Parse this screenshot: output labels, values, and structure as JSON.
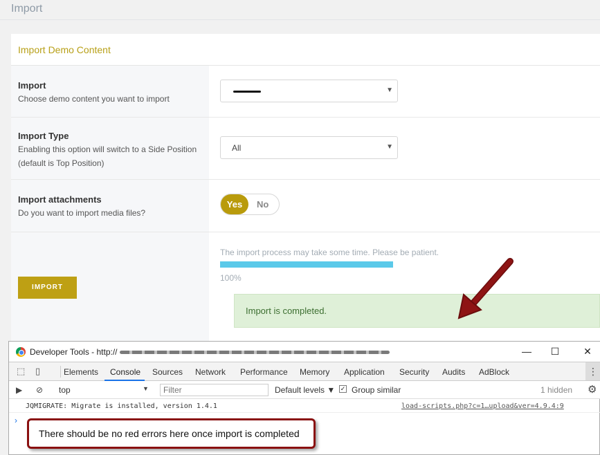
{
  "page": {
    "title": "Import"
  },
  "panel": {
    "title": "Import Demo Content",
    "rows": [
      {
        "label": "Import",
        "desc": [
          "Choose demo content you want to import"
        ],
        "select_value": ""
      },
      {
        "label": "Import Type",
        "desc": [
          "Enabling this option will switch to a Side Position",
          "(default is Top Position)"
        ],
        "select_value": "All"
      },
      {
        "label": "Import attachments",
        "desc": [
          "Do you want to import media files?"
        ],
        "toggle": {
          "on_label": "Yes",
          "off_label": "No",
          "selected": "Yes"
        }
      }
    ],
    "import_button": "IMPORT",
    "patience_text": "The import process may take some time. Please be patient.",
    "progress": 100,
    "progress_label": "100%",
    "completed_text": "Import is completed."
  },
  "devtools": {
    "title": "Developer Tools - http://",
    "window_controls": {
      "minimize": "—",
      "maximize": "☐",
      "close": "✕"
    },
    "tabs": [
      "Elements",
      "Console",
      "Sources",
      "Network",
      "Performance",
      "Memory",
      "Application",
      "Security",
      "Audits",
      "AdBlock"
    ],
    "active_tab": "Console",
    "context": "top",
    "filter_placeholder": "Filter",
    "levels": "Default levels ▼",
    "group_similar": "Group similar",
    "hidden_count": "1 hidden",
    "log": {
      "message": "JQMIGRATE: Migrate is installed, version 1.4.1",
      "source": "load-scripts.php?c=1…upload&ver=4.9.4:9"
    },
    "prompt_symbol": "›"
  },
  "annotation": {
    "callout_text": "There should be no red errors here once import is completed"
  },
  "colors": {
    "accent": "#b99b0c",
    "progress": "#5bc9e9",
    "success_bg": "#dff0d8",
    "callout_border": "#8a1010"
  }
}
